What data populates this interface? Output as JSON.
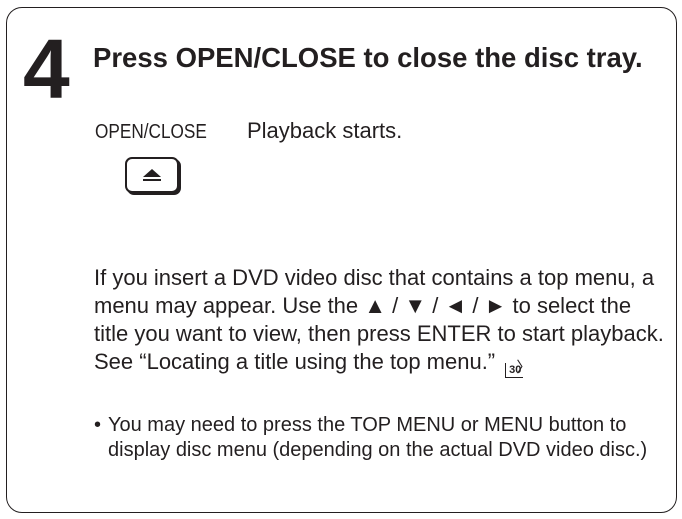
{
  "step": {
    "number": "4",
    "title": "Press OPEN/CLOSE to close the disc tray."
  },
  "action": {
    "button_caption": "OPEN/CLOSE",
    "result": "Playback starts.",
    "button_icon": "eject-icon"
  },
  "body": {
    "part1": "If you insert a DVD video disc that contains a top menu, a menu may appear. Use the ▲ / ▼ / ◄ / ► to select the title you want to view, then press ENTER to start playback. See “Locating a title using the top menu.”",
    "page_ref": "30"
  },
  "note": {
    "bullet": "•",
    "text": "You may need to press the TOP MENU or MENU button to display disc menu (depending on the actual DVD video disc.)"
  }
}
